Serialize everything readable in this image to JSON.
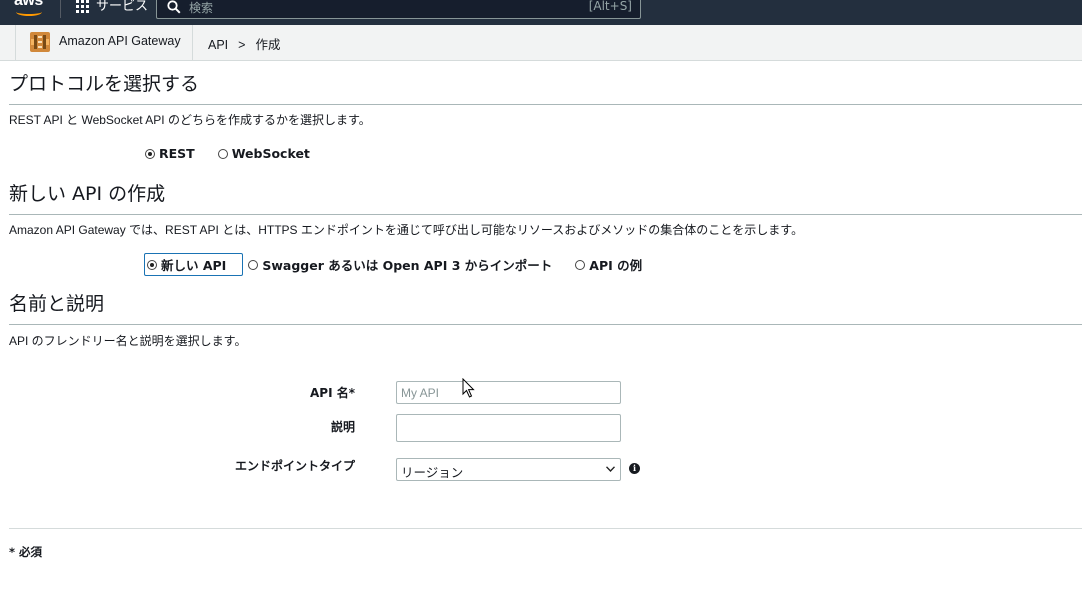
{
  "topnav": {
    "logo_text": "aws",
    "services_label": "サービス",
    "search_placeholder": "検索",
    "search_shortcut": "[Alt+S]"
  },
  "breadcrumb": {
    "service_name": "Amazon API Gateway",
    "items": [
      "API",
      "作成"
    ],
    "separator": ">"
  },
  "protocol": {
    "title": "プロトコルを選択する",
    "description": "REST API と WebSocket API のどちらを作成するかを選択します。",
    "options": [
      {
        "label": "REST",
        "selected": true
      },
      {
        "label": "WebSocket",
        "selected": false
      }
    ]
  },
  "new_api": {
    "title": "新しい API の作成",
    "description": "Amazon API Gateway では、REST API とは、HTTPS エンドポイントを通じて呼び出し可能なリソースおよびメソッドの集合体のことを示します。",
    "options": [
      {
        "label": "新しい API",
        "selected": true
      },
      {
        "label": "Swagger あるいは Open API 3 からインポート",
        "selected": false
      },
      {
        "label": "API の例",
        "selected": false
      }
    ]
  },
  "name_desc": {
    "title": "名前と説明",
    "description": "API のフレンドリー名と説明を選択します。",
    "api_name_label": "API 名*",
    "api_name_placeholder": "My API",
    "api_name_value": "",
    "description_label": "説明",
    "description_value": "",
    "endpoint_type_label": "エンドポイントタイプ",
    "endpoint_type_value": "リージョン"
  },
  "footer": {
    "required_note": "* 必須"
  },
  "colors": {
    "nav_bg": "#232f3e",
    "aws_orange": "#ff9900",
    "crumb_bg": "#f2f3f3",
    "focus_blue": "#1a73b4"
  }
}
